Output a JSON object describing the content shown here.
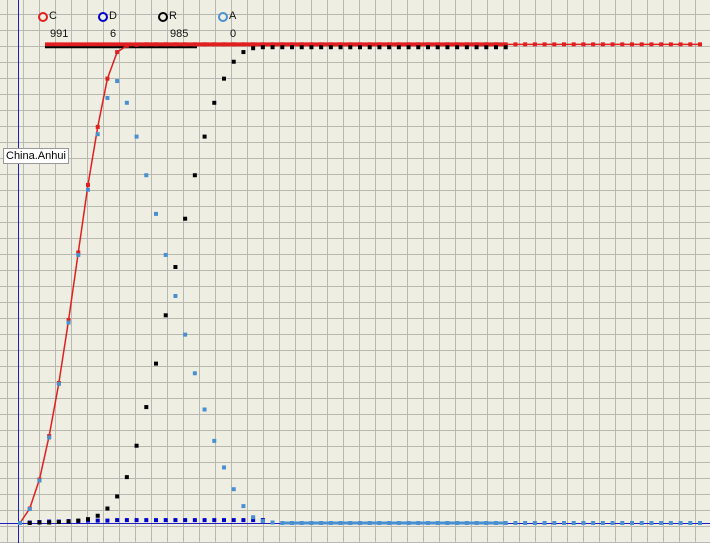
{
  "region_label": "China.Anhui",
  "legend": [
    {
      "label": "C",
      "count": "991",
      "color": "#e02020"
    },
    {
      "label": "D",
      "count": "6",
      "color": "#0000cc"
    },
    {
      "label": "R",
      "count": "985",
      "color": "#000000"
    },
    {
      "label": "A",
      "count": "0",
      "color": "#4a90d0"
    }
  ],
  "colors": {
    "background": "#efeee2",
    "grid": "#b8b8b0",
    "axis": "#2020c0"
  },
  "chart_data": {
    "type": "scatter",
    "title": "",
    "xlabel": "",
    "ylabel": "",
    "grid": true,
    "legend_placement": "top-left",
    "xlim": [
      0,
      70
    ],
    "ylim": [
      0,
      1000
    ],
    "series": [
      {
        "name": "C",
        "color": "#e02020",
        "line": true,
        "x": [
          0,
          1,
          2,
          3,
          4,
          5,
          6,
          7,
          8,
          9,
          10,
          11,
          12,
          13,
          14,
          15,
          16,
          17,
          18,
          19,
          20,
          21,
          22,
          23,
          24,
          25,
          26,
          27,
          28,
          29,
          30,
          31,
          32,
          33,
          34,
          35,
          36,
          37,
          38,
          39,
          40,
          41,
          42,
          43,
          44,
          45,
          46,
          47,
          48,
          49,
          50,
          51,
          52,
          53,
          54,
          55,
          56,
          57,
          58,
          59,
          60,
          61,
          62,
          63,
          64,
          65,
          66,
          67,
          68,
          69,
          70
        ],
        "y": [
          0,
          30,
          90,
          180,
          290,
          420,
          560,
          700,
          820,
          920,
          975,
          988,
          990,
          991,
          991,
          991,
          991,
          991,
          991,
          991,
          991,
          991,
          991,
          991,
          991,
          991,
          991,
          991,
          991,
          991,
          991,
          991,
          991,
          991,
          991,
          991,
          991,
          991,
          991,
          991,
          991,
          991,
          991,
          991,
          991,
          991,
          991,
          991,
          991,
          991,
          991,
          991,
          991,
          991,
          991,
          991,
          991,
          991,
          991,
          991,
          991,
          991,
          991,
          991,
          991,
          991,
          991,
          991,
          991,
          991,
          991
        ]
      },
      {
        "name": "D",
        "color": "#0000cc",
        "line": false,
        "x": [
          0,
          1,
          2,
          3,
          4,
          5,
          6,
          7,
          8,
          9,
          10,
          11,
          12,
          13,
          14,
          15,
          16,
          17,
          18,
          19,
          20,
          21,
          22,
          23,
          24,
          25
        ],
        "y": [
          0,
          1,
          2,
          3,
          3,
          4,
          4,
          5,
          5,
          5,
          6,
          6,
          6,
          6,
          6,
          6,
          6,
          6,
          6,
          6,
          6,
          6,
          6,
          6,
          6,
          6
        ]
      },
      {
        "name": "R",
        "color": "#000000",
        "line": false,
        "x": [
          0,
          1,
          2,
          3,
          4,
          5,
          6,
          7,
          8,
          9,
          10,
          11,
          12,
          13,
          14,
          15,
          16,
          17,
          18,
          19,
          20,
          21,
          22,
          23,
          24,
          25,
          26,
          27,
          28,
          29,
          30,
          31,
          32,
          33,
          34,
          35,
          36,
          37,
          38,
          39,
          40,
          41,
          42,
          43,
          44,
          45,
          46,
          47,
          48,
          49,
          50
        ],
        "y": [
          0,
          0,
          1,
          1,
          2,
          3,
          5,
          8,
          15,
          30,
          55,
          95,
          160,
          240,
          330,
          430,
          530,
          630,
          720,
          800,
          870,
          920,
          955,
          975,
          983,
          985,
          985,
          985,
          985,
          985,
          985,
          985,
          985,
          985,
          985,
          985,
          985,
          985,
          985,
          985,
          985,
          985,
          985,
          985,
          985,
          985,
          985,
          985,
          985,
          985,
          985
        ]
      },
      {
        "name": "A",
        "color": "#4a90d0",
        "line": false,
        "x": [
          0,
          1,
          2,
          3,
          4,
          5,
          6,
          7,
          8,
          9,
          10,
          11,
          12,
          13,
          14,
          15,
          16,
          17,
          18,
          19,
          20,
          21,
          22,
          23,
          24,
          25,
          26,
          27,
          28,
          29,
          30,
          31,
          32,
          33,
          34,
          35,
          36,
          37,
          38,
          39,
          40,
          41,
          42,
          43,
          44,
          45,
          46,
          47,
          48,
          49,
          50,
          51,
          52,
          53,
          54,
          55,
          56,
          57,
          58,
          59,
          60,
          61,
          62,
          63,
          64,
          65,
          66,
          67,
          68,
          69,
          70
        ],
        "y": [
          0,
          29,
          88,
          177,
          288,
          415,
          555,
          690,
          805,
          880,
          915,
          870,
          800,
          720,
          640,
          555,
          470,
          390,
          310,
          235,
          170,
          115,
          70,
          35,
          12,
          4,
          1,
          0,
          0,
          0,
          0,
          0,
          0,
          0,
          0,
          0,
          0,
          0,
          0,
          0,
          0,
          0,
          0,
          0,
          0,
          0,
          0,
          0,
          0,
          0,
          0,
          0,
          0,
          0,
          0,
          0,
          0,
          0,
          0,
          0,
          0,
          0,
          0,
          0,
          0,
          0,
          0,
          0,
          0,
          0,
          0
        ]
      }
    ]
  }
}
